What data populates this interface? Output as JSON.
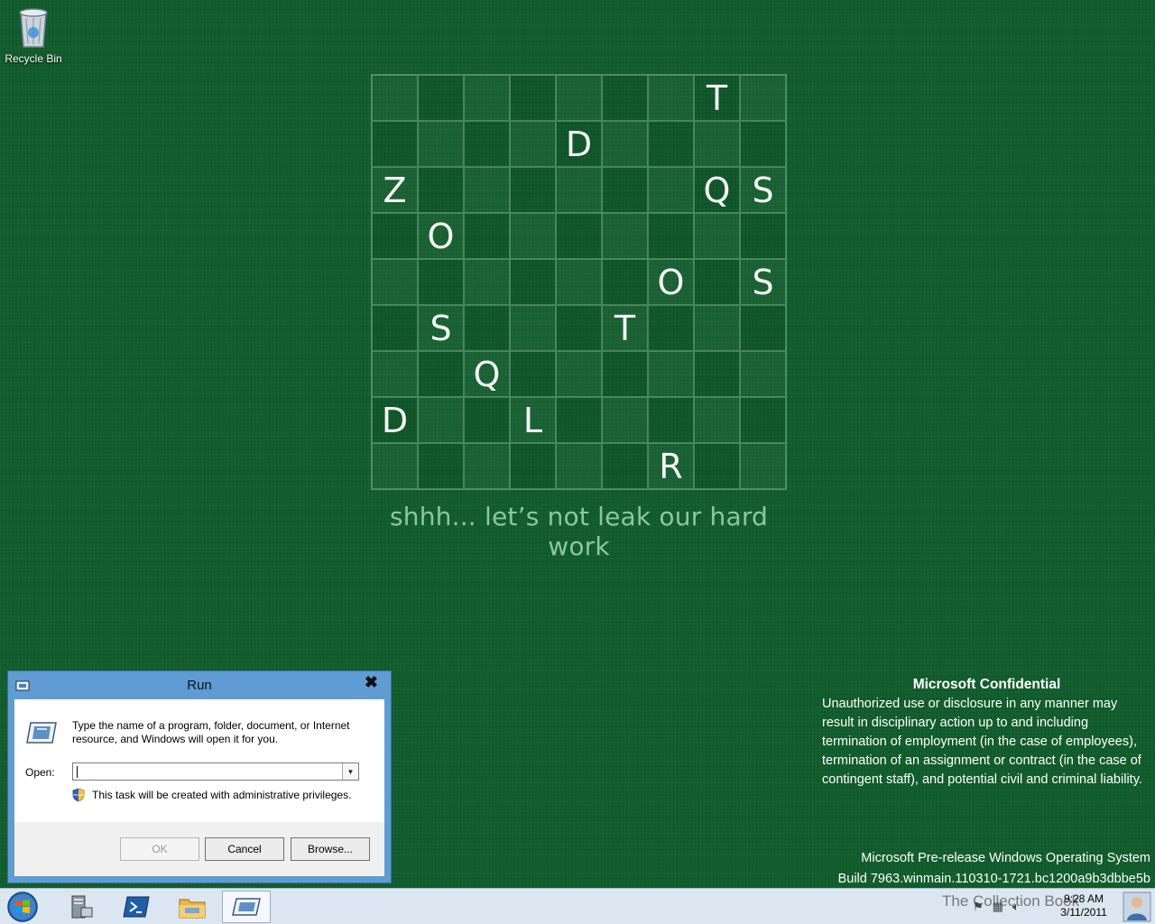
{
  "desktop": {
    "icons": [
      {
        "label": "Recycle Bin",
        "icon": "recycle-bin-icon"
      }
    ]
  },
  "grid": {
    "rows": [
      [
        "",
        "",
        "",
        "",
        "",
        "",
        "",
        "T",
        ""
      ],
      [
        "",
        "",
        "",
        "",
        "D",
        "",
        "",
        "",
        ""
      ],
      [
        "Z",
        "",
        "",
        "",
        "",
        "",
        "",
        "Q",
        "S"
      ],
      [
        "",
        "O",
        "",
        "",
        "",
        "",
        "",
        "",
        ""
      ],
      [
        "",
        "",
        "",
        "",
        "",
        "",
        "O",
        "",
        "S"
      ],
      [
        "",
        "S",
        "",
        "",
        "",
        "T",
        "",
        "",
        ""
      ],
      [
        "",
        "",
        "Q",
        "",
        "",
        "",
        "",
        "",
        ""
      ],
      [
        "D",
        "",
        "",
        "L",
        "",
        "",
        "",
        "",
        ""
      ],
      [
        "",
        "",
        "",
        "",
        "",
        "",
        "R",
        "",
        ""
      ]
    ],
    "tagline": "shhh... let’s not leak our hard work"
  },
  "confidential": {
    "title": "Microsoft Confidential",
    "text": "Unauthorized use or disclosure in any manner may result in disciplinary action up to and including termination of employment (in the case of employees), termination of an assignment or contract (in the case of contingent staff), and potential civil and criminal liability."
  },
  "build": {
    "line1": "Microsoft Pre-release Windows Operating System",
    "line2": "Build 7963.winmain.110310-1721.bc1200a9b3dbbe5b"
  },
  "run_dialog": {
    "title": "Run",
    "close_glyph": "✖",
    "description": "Type the name of a program, folder, document, or Internet resource, and Windows will open it for you.",
    "open_label": "Open:",
    "open_value": "",
    "admin_note": "This task will be created with administrative privileges.",
    "ok_label": "OK",
    "cancel_label": "Cancel",
    "browse_label": "Browse..."
  },
  "taskbar": {
    "buttons": [
      "start-orb-icon",
      "server-manager-icon",
      "powershell-icon",
      "file-explorer-icon",
      "run-icon"
    ],
    "watermark": "The Collection Book",
    "time": "9:28 AM",
    "date": "3/11/2011"
  },
  "colors": {
    "desktop_bg": "#0f5a2a",
    "dialog_frame": "#5e9cd3",
    "taskbar_bg": "#dbe6f0",
    "tagline": "#8cc69f"
  }
}
